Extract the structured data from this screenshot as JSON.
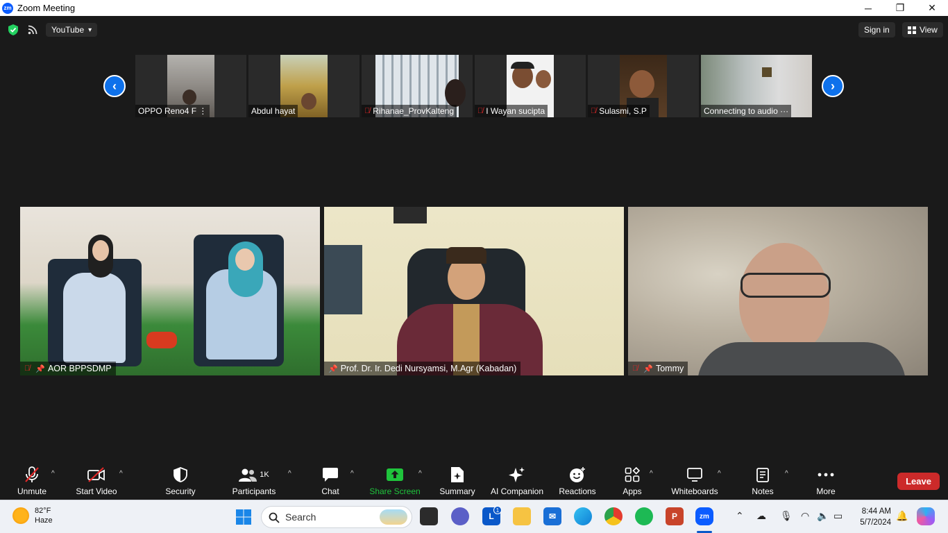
{
  "window": {
    "title": "Zoom Meeting",
    "logo_text": "zm",
    "minimize": "─",
    "restore": "❐",
    "close": "✕"
  },
  "topbar": {
    "stream_label": "YouTube",
    "caret": "▾",
    "signin_label": "Sign in",
    "view_label": "View"
  },
  "strip": {
    "prev_icon": "‹",
    "next_icon": "›",
    "thumbnails": [
      {
        "name": "OPPO Reno4 F",
        "muted": false,
        "extra": "⋮"
      },
      {
        "name": "Abdul hayat",
        "muted": false
      },
      {
        "name": "Rihanae_ProvKalteng",
        "muted": true
      },
      {
        "name": "I Wayan sucipta",
        "muted": true
      },
      {
        "name": "Sulasmi, S.P",
        "muted": true
      },
      {
        "name": "Connecting to audio ···",
        "muted": false
      }
    ]
  },
  "videos": [
    {
      "name": "AOR BPPSDMP",
      "muted": true,
      "pinned": true
    },
    {
      "name": "Prof. Dr. Ir. Dedi Nursyamsi, M.Agr (Kabadan)",
      "muted": false,
      "pinned": true
    },
    {
      "name": "Tommy",
      "muted": true,
      "pinned": true
    }
  ],
  "controls": {
    "unmute": "Unmute",
    "start_video": "Start Video",
    "security": "Security",
    "participants": "Participants",
    "participants_count": "1K",
    "chat": "Chat",
    "share_screen": "Share Screen",
    "summary": "Summary",
    "ai_companion": "AI Companion",
    "reactions": "Reactions",
    "apps": "Apps",
    "whiteboards": "Whiteboards",
    "notes": "Notes",
    "more": "More",
    "leave": "Leave",
    "caret": "^"
  },
  "taskbar": {
    "temperature": "82°F",
    "condition": "Haze",
    "search_placeholder": "Search",
    "time": "8:44 AM",
    "date": "5/7/2024",
    "badge_count": "1",
    "icons": [
      "windows-start-icon",
      "search-icon",
      "task-view-icon",
      "teams-icon",
      "l-app-icon",
      "file-explorer-icon",
      "mail-icon",
      "edge-icon",
      "chrome-icon",
      "spotify-icon",
      "powerpoint-icon",
      "zoom-icon"
    ]
  },
  "colors": {
    "zoom_blue": "#0b5cff",
    "leave_red": "#cc2a2a",
    "share_green": "#1fc43c",
    "mute_red": "#e02828"
  }
}
